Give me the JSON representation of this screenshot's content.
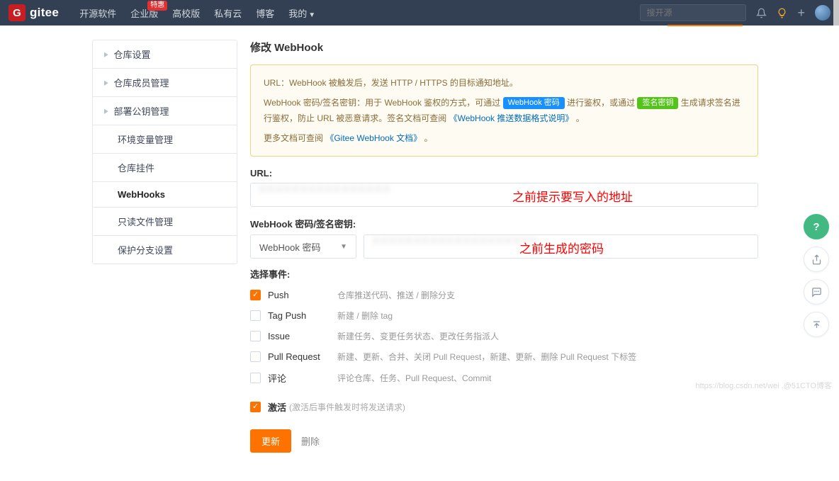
{
  "topbar": {
    "brand": "gitee",
    "nav": {
      "opensource": "开源软件",
      "enterprise": "企业版",
      "enterprise_badge": "特惠",
      "edu": "高校版",
      "private": "私有云",
      "blog": "博客",
      "mine": "我的"
    },
    "search_placeholder": "搜开源"
  },
  "sidebar": {
    "items": [
      {
        "label": "仓库设置",
        "expandable": true
      },
      {
        "label": "仓库成员管理",
        "expandable": true
      },
      {
        "label": "部署公钥管理",
        "expandable": true
      },
      {
        "label": "环境变量管理",
        "expandable": false
      },
      {
        "label": "仓库挂件",
        "expandable": false
      },
      {
        "label": "WebHooks",
        "expandable": false,
        "active": true
      },
      {
        "label": "只读文件管理",
        "expandable": false
      },
      {
        "label": "保护分支设置",
        "expandable": false
      }
    ]
  },
  "main": {
    "title": "修改 WebHook",
    "info": {
      "line1_pre": "URL：WebHook 被触发后，发送 HTTP / HTTPS 的目标通知地址。",
      "line2_a": "WebHook 密码/签名密钥：用于 WebHook 鉴权的方式，可通过 ",
      "pill_pwd": "WebHook 密码",
      "line2_b": " 进行鉴权，或通过 ",
      "pill_sig": "签名密钥",
      "line2_c": " 生成请求签名进行鉴权，防止 URL 被恶意请求。签名文档可查阅 ",
      "link1": "《WebHook 推送数据格式说明》",
      "line2_d": " 。",
      "line3_a": "更多文档可查阅 ",
      "link2": "《Gitee WebHook 文档》",
      "line3_b": " 。"
    },
    "url_label": "URL:",
    "pwd_label": "WebHook 密码/签名密钥:",
    "pwd_select": "WebHook 密码",
    "events_label": "选择事件:",
    "events": [
      {
        "name": "Push",
        "desc": "仓库推送代码、推送 / 删除分支",
        "checked": true
      },
      {
        "name": "Tag Push",
        "desc": "新建 / 删除 tag",
        "checked": false
      },
      {
        "name": "Issue",
        "desc": "新建任务、变更任务状态、更改任务指派人",
        "checked": false
      },
      {
        "name": "Pull Request",
        "desc": "新建、更新、合并、关闭 Pull Request，新建、更新、删除 Pull Request 下标签",
        "checked": false
      },
      {
        "name": "评论",
        "desc": "评论仓库、任务、Pull Request、Commit",
        "checked": false
      }
    ],
    "activate": {
      "label": "激活",
      "hint": "(激活后事件触发时将发送请求)",
      "checked": true
    },
    "update_btn": "更新",
    "delete_btn": "删除"
  },
  "annotations": {
    "url_note": "之前提示要写入的地址",
    "pwd_note": "之前生成的密码"
  },
  "watermark": "https://blog.csdn.net/wei .@51CTO博客"
}
